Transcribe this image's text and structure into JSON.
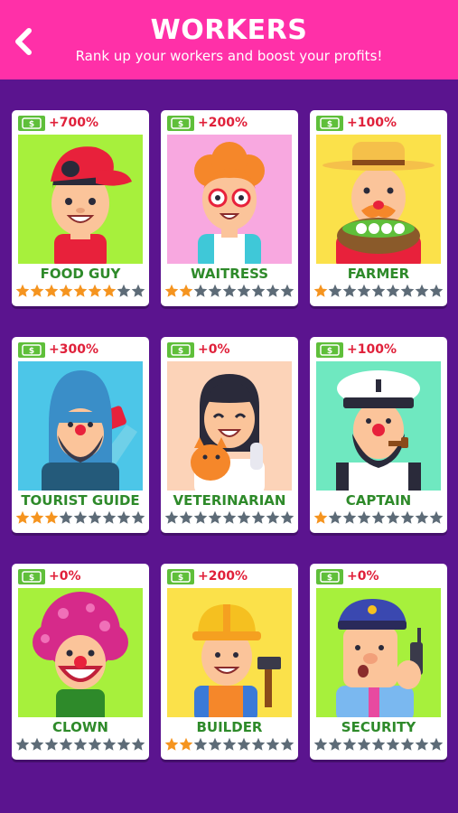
{
  "header": {
    "title": "WORKERS",
    "subtitle": "Rank up your workers and boost your profits!",
    "back_icon": "chevron-left-icon",
    "color": "#ff30a8"
  },
  "background_color": "#5b148f",
  "star_colors": {
    "filled": "#f5941f",
    "empty": "#5d6b77"
  },
  "workers": [
    {
      "name": "FOOD GUY",
      "bonus": "+700%",
      "rank": 7,
      "max_rank": 9,
      "portrait_bg": "#a7f03c"
    },
    {
      "name": "WAITRESS",
      "bonus": "+200%",
      "rank": 2,
      "max_rank": 9,
      "portrait_bg": "#f8a8e0"
    },
    {
      "name": "FARMER",
      "bonus": "+100%",
      "rank": 1,
      "max_rank": 9,
      "portrait_bg": "#fbe14a"
    },
    {
      "name": "TOURIST GUIDE",
      "bonus": "+300%",
      "rank": 3,
      "max_rank": 9,
      "portrait_bg": "#4cc6e8"
    },
    {
      "name": "VETERINARIAN",
      "bonus": "+0%",
      "rank": 0,
      "max_rank": 9,
      "portrait_bg": "#fcd3b8"
    },
    {
      "name": "CAPTAIN",
      "bonus": "+100%",
      "rank": 1,
      "max_rank": 9,
      "portrait_bg": "#6fe8c0"
    },
    {
      "name": "CLOWN",
      "bonus": "+0%",
      "rank": 0,
      "max_rank": 9,
      "portrait_bg": "#a7f03c"
    },
    {
      "name": "BUILDER",
      "bonus": "+200%",
      "rank": 2,
      "max_rank": 9,
      "portrait_bg": "#fbe14a"
    },
    {
      "name": "SECURITY",
      "bonus": "+0%",
      "rank": 0,
      "max_rank": 9,
      "portrait_bg": "#a7f03c"
    }
  ]
}
